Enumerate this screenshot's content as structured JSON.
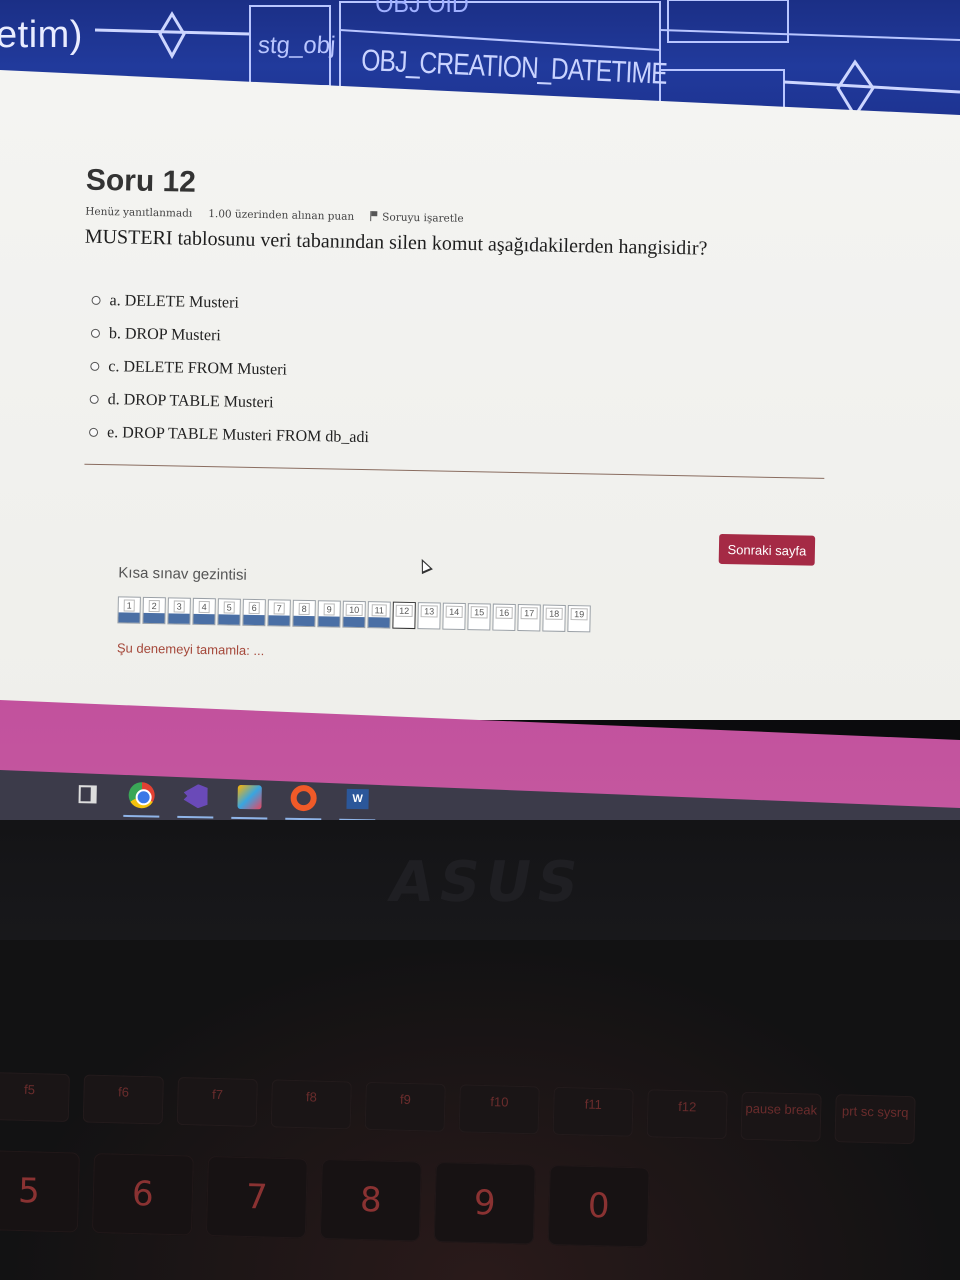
{
  "banner": {
    "title_fragment": "etim)",
    "label_obj": "stg_obj",
    "label_creation": "OBJ_CREATION_DATETIME",
    "label_top": "OBJ OID"
  },
  "question": {
    "title": "Soru 12",
    "status": "Henüz yanıtlanmadı",
    "points": "1.00 üzerinden alınan puan",
    "flag_label": "Soruyu işaretle",
    "text": "MUSTERI tablosunu veri tabanından silen komut aşağıdakilerden hangisidir?",
    "answers": [
      "a. DELETE Musteri",
      "b. DROP Musteri",
      "c. DELETE FROM Musteri",
      "d. DROP TABLE Musteri",
      "e. DROP TABLE Musteri FROM db_adi"
    ]
  },
  "next_button": "Sonraki sayfa",
  "navigation": {
    "title": "Kısa sınav gezintisi",
    "cells": [
      "1",
      "2",
      "3",
      "4",
      "5",
      "6",
      "7",
      "8",
      "9",
      "10",
      "11",
      "12",
      "13",
      "14",
      "15",
      "16",
      "17",
      "18",
      "19"
    ],
    "answered_count": 11,
    "current": 12,
    "finish_link": "Şu denemeyi tamamla: ..."
  },
  "taskbar": {
    "icons": [
      "task-view-icon",
      "chrome-icon",
      "visual-studio-icon",
      "paint-icon",
      "app-ring-icon",
      "word-icon"
    ],
    "word_label": "W"
  },
  "laptop": {
    "brand": "ASUS",
    "fkeys": [
      "f5",
      "f6",
      "f7",
      "f8",
      "f9",
      "f10",
      "f11",
      "f12",
      "pause break",
      "prt sc sysrq"
    ],
    "number_keys": [
      "5",
      "6",
      "7",
      "8",
      "9",
      "0"
    ]
  },
  "colors": {
    "banner_blue": "#213a9c",
    "accent_button": "#a52a45",
    "footer_pink": "#c2519d",
    "answered_blue": "#4a6fa5"
  }
}
